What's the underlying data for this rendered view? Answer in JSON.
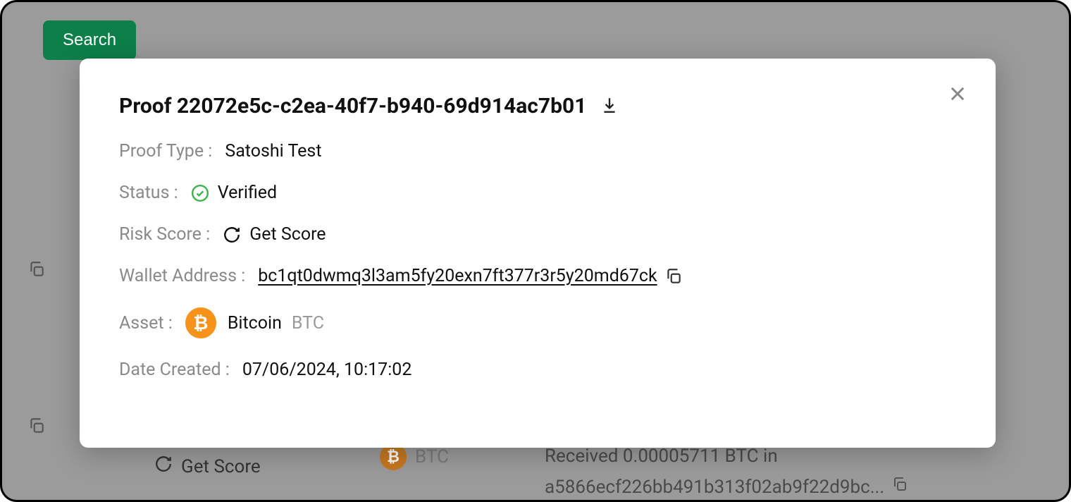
{
  "background": {
    "search_label": "Search",
    "get_score_label": "Get Score",
    "asset_ticker": "BTC",
    "received_line1": "Received 0.00005711 BTC in",
    "received_line2": "a5866ecf226bb491b313f02ab9f22d9bc..."
  },
  "modal": {
    "title": "Proof 22072e5c-c2ea-40f7-b940-69d914ac7b01",
    "fields": {
      "proof_type": {
        "label": "Proof Type",
        "value": "Satoshi Test"
      },
      "status": {
        "label": "Status",
        "value": "Verified"
      },
      "risk_score": {
        "label": "Risk Score",
        "value": "Get Score"
      },
      "wallet_address": {
        "label": "Wallet Address",
        "value": "bc1qt0dwmq3l3am5fy20exn7ft377r3r5y20md67ck"
      },
      "asset": {
        "label": "Asset",
        "name": "Bitcoin",
        "ticker": "BTC"
      },
      "date_created": {
        "label": "Date Created",
        "value": "07/06/2024, 10:17:02"
      }
    }
  }
}
